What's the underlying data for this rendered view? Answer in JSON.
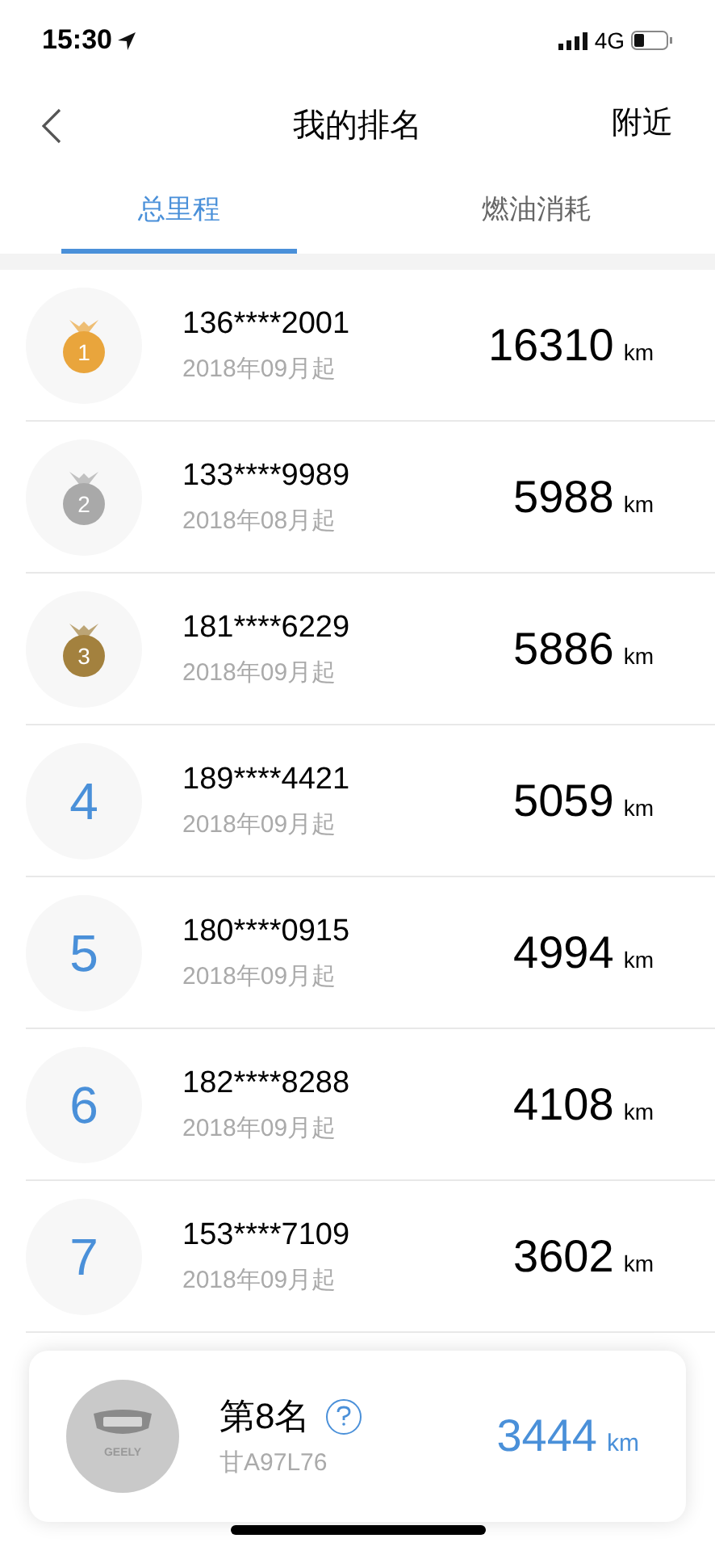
{
  "status_bar": {
    "time": "15:30",
    "network": "4G"
  },
  "nav": {
    "title": "我的排名",
    "action": "附近"
  },
  "tabs": [
    {
      "label": "总里程",
      "selected": true
    },
    {
      "label": "燃油消耗",
      "selected": false
    }
  ],
  "rows": [
    {
      "kind": "medal",
      "rank": "1",
      "color": "#e9a53c",
      "phone": "136****2001",
      "since": "2018年09月起",
      "distance": "16310",
      "unit": "km"
    },
    {
      "kind": "medal",
      "rank": "2",
      "color": "#a9a9a9",
      "phone": "133****9989",
      "since": "2018年08月起",
      "distance": "5988",
      "unit": "km"
    },
    {
      "kind": "medal",
      "rank": "3",
      "color": "#a3813e",
      "phone": "181****6229",
      "since": "2018年09月起",
      "distance": "5886",
      "unit": "km"
    },
    {
      "kind": "number",
      "rank": "4",
      "phone": "189****4421",
      "since": "2018年09月起",
      "distance": "5059",
      "unit": "km"
    },
    {
      "kind": "number",
      "rank": "5",
      "phone": "180****0915",
      "since": "2018年09月起",
      "distance": "4994",
      "unit": "km"
    },
    {
      "kind": "number",
      "rank": "6",
      "phone": "182****8288",
      "since": "2018年09月起",
      "distance": "4108",
      "unit": "km"
    },
    {
      "kind": "number",
      "rank": "7",
      "phone": "153****7109",
      "since": "2018年09月起",
      "distance": "3602",
      "unit": "km"
    }
  ],
  "my_rank": {
    "logo_text": "GEELY",
    "title": "第8名",
    "plate": "甘A97L76",
    "distance": "3444",
    "unit": "km"
  }
}
